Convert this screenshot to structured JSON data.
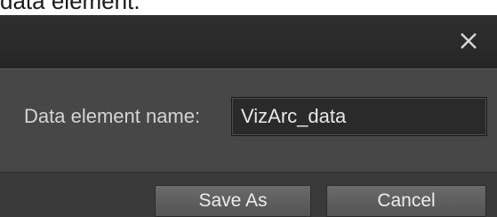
{
  "caption": "data element.",
  "dialog": {
    "close_icon": "close-icon",
    "field_label": "Data element name:",
    "name_value": "VizArc_data",
    "save_as_label": "Save As",
    "cancel_label": "Cancel"
  },
  "colors": {
    "titlebar": "#2a2a2a",
    "body": "#474747",
    "footer": "#3a3a3a",
    "button": "#5e5e5e",
    "text": "#d4d4d4"
  }
}
